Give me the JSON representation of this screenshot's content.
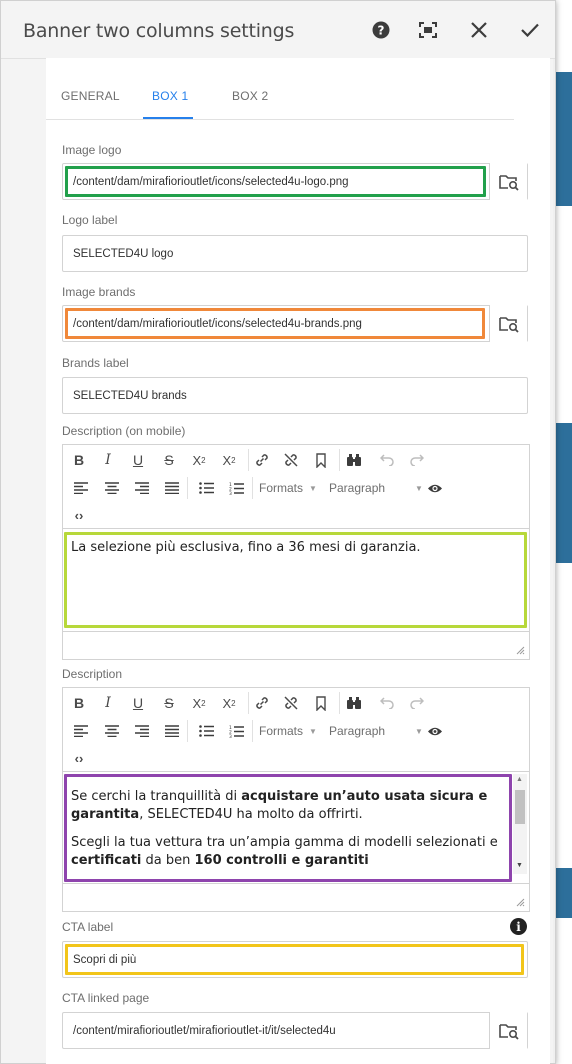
{
  "dialog": {
    "title": "Banner two columns settings",
    "header_buttons": [
      {
        "name": "help-icon",
        "glyph": "?"
      },
      {
        "name": "fullscreen-icon",
        "glyph": "▣"
      },
      {
        "name": "close-icon",
        "glyph": "✕"
      },
      {
        "name": "done-icon",
        "glyph": "✓"
      }
    ]
  },
  "tabs": [
    {
      "label": "GENERAL",
      "active": false
    },
    {
      "label": "BOX 1",
      "active": true
    },
    {
      "label": "BOX 2",
      "active": false
    }
  ],
  "fields": {
    "image_logo": {
      "label": "Image logo",
      "value": "/content/dam/mirafiorioutlet/icons/selected4u-logo.png"
    },
    "logo_label": {
      "label": "Logo label",
      "value": "SELECTED4U logo"
    },
    "image_brands": {
      "label": "Image brands",
      "value": "/content/dam/mirafiorioutlet/icons/selected4u-brands.png"
    },
    "brands_label": {
      "label": "Brands label",
      "value": "SELECTED4U brands"
    },
    "description_mobile": {
      "label": "Description (on mobile)",
      "text": "La selezione più esclusiva, fino a 36 mesi di garanzia."
    },
    "description": {
      "label": "Description",
      "p1_a": "Se cerchi la tranquillità di ",
      "p1_b": "acquistare un’auto usata sicura e garantita",
      "p1_c": ", SELECTED4U ha molto da offrirti.",
      "p2_a": "Scegli la tua vettura tra un’ampia gamma di modelli selezionati e ",
      "p2_b": "certificati",
      "p2_c": " da ben ",
      "p2_d": "160 controlli e garantiti"
    },
    "cta_label": {
      "label": "CTA label",
      "value": "Scopri di più"
    },
    "cta_linked_page": {
      "label": "CTA linked page",
      "value": "/content/mirafiorioutlet/mirafiorioutlet-it/it/selected4u"
    }
  },
  "rte_toolbar": {
    "formats_label": "Formats",
    "paragraph_label": "Paragraph",
    "source_glyph": "‹›"
  },
  "colors": {
    "accent": "#2680eb",
    "highlight_green": "#22a04b",
    "highlight_orange": "#f0883a",
    "highlight_lime": "#b7d83a",
    "highlight_purple": "#8e44ad",
    "highlight_yellow": "#f2c51a"
  }
}
